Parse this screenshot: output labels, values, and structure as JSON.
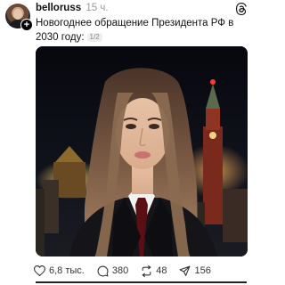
{
  "post": {
    "username": "belloruss",
    "time": "15 ч.",
    "caption": "Новогоднее обращение Президента РФ в 2030 году:",
    "page_indicator": "1/2",
    "image_label": "",
    "actions": {
      "likes": "6,8 тыс.",
      "comments": "380",
      "reposts": "48",
      "shares": "156"
    }
  },
  "icons": {
    "avatar": "avatar",
    "add": "plus-icon",
    "app": "threads-logo-icon",
    "like": "heart-icon",
    "comment": "comment-icon",
    "repost": "repost-icon",
    "share": "share-icon"
  }
}
